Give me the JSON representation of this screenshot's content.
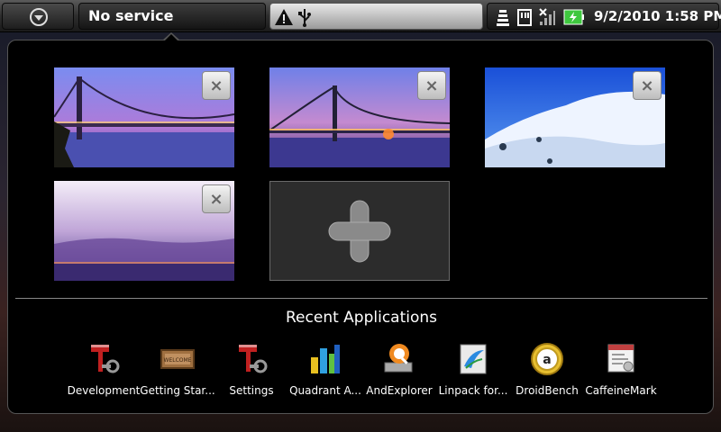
{
  "statusbar": {
    "notification": "No service",
    "datetime": "9/2/2010 1:58 PM",
    "icons": [
      "menu-dropdown-icon",
      "warning-icon",
      "usb-icon",
      "wifi-icon",
      "sd-card-icon",
      "no-signal-icon",
      "battery-charging-icon"
    ]
  },
  "thumbnails": [
    {
      "name": "bay-bridge-dusk",
      "close_label": "×"
    },
    {
      "name": "bay-bridge-lights",
      "close_label": "×"
    },
    {
      "name": "snowy-mountain",
      "close_label": "×"
    },
    {
      "name": "foggy-city",
      "close_label": "×"
    }
  ],
  "recent": {
    "title": "Recent Applications",
    "apps": [
      {
        "label": "Development",
        "icon": "development-icon"
      },
      {
        "label": "Getting Star...",
        "icon": "welcome-mat-icon"
      },
      {
        "label": "Settings",
        "icon": "settings-icon"
      },
      {
        "label": "Quadrant A...",
        "icon": "bar-chart-icon"
      },
      {
        "label": "AndExplorer",
        "icon": "file-explorer-icon"
      },
      {
        "label": "Linpack for...",
        "icon": "linpack-icon"
      },
      {
        "label": "DroidBench",
        "icon": "droidbench-icon"
      },
      {
        "label": "CaffeineMark",
        "icon": "caffeinemark-icon"
      }
    ]
  },
  "colors": {
    "panel_bg": "#000000",
    "battery_green": "#3ec83e"
  }
}
